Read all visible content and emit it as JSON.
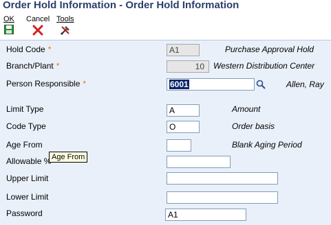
{
  "window": {
    "title": "Order Hold Information - Order Hold Information"
  },
  "toolbar": {
    "ok_label": "OK",
    "cancel_label": "Cancel",
    "tools_label": "Tools",
    "ok_icon": "save-disk-icon",
    "cancel_icon": "red-x-icon",
    "tools_icon": "tools-icon"
  },
  "form": {
    "hold_code": {
      "label": "Hold Code",
      "value": "A1",
      "description": "Purchase Approval Hold"
    },
    "branch_plant": {
      "label": "Branch/Plant",
      "value": "10",
      "description": "Western Distribution Center"
    },
    "person_responsible": {
      "label": "Person Responsible",
      "value": "6001",
      "description": "Allen, Ray"
    },
    "limit_type": {
      "label": "Limit Type",
      "value": "A",
      "description": "Amount"
    },
    "code_type": {
      "label": "Code Type",
      "value": "O",
      "description": "Order basis"
    },
    "age_from": {
      "label": "Age From",
      "value": "",
      "description": "Blank Aging Period"
    },
    "allowable": {
      "label": "Allowable %",
      "value": ""
    },
    "upper_limit": {
      "label": "Upper Limit",
      "value": ""
    },
    "lower_limit": {
      "label": "Lower Limit",
      "value": ""
    },
    "password": {
      "label": "Password",
      "value": "A1"
    },
    "required_marker": "*"
  },
  "tooltip": {
    "text": "Age From"
  },
  "colors": {
    "title": "#2b3f6b",
    "form_bg": "#eaf0f9",
    "required": "#e07a00",
    "selection": "#0a246a"
  }
}
